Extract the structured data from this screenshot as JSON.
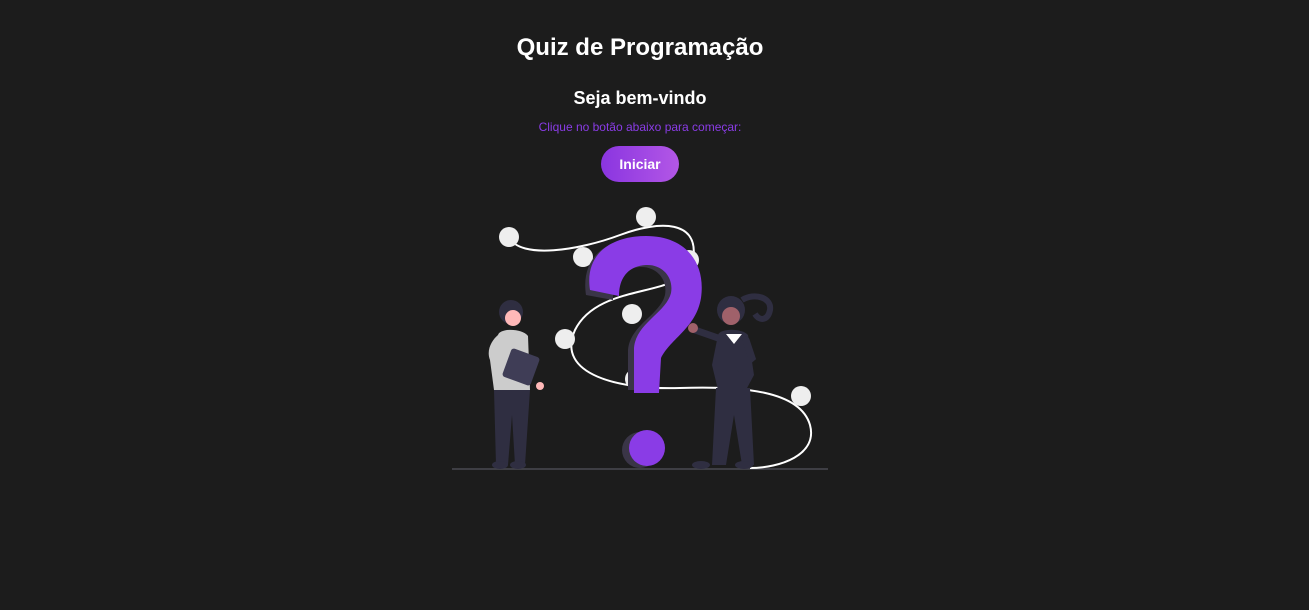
{
  "header": {
    "title": "Quiz de Programação"
  },
  "welcome": {
    "heading": "Seja bem-vindo",
    "instruction": "Clique no botão abaixo para começar:",
    "start_label": "Iniciar"
  },
  "colors": {
    "background": "#1c1c1c",
    "accent": "#8a3ce6",
    "button_gradient_start": "#8a35e0",
    "button_gradient_end": "#b357e6",
    "text": "#ffffff"
  },
  "illustration": {
    "icon": "question-people-illustration"
  }
}
